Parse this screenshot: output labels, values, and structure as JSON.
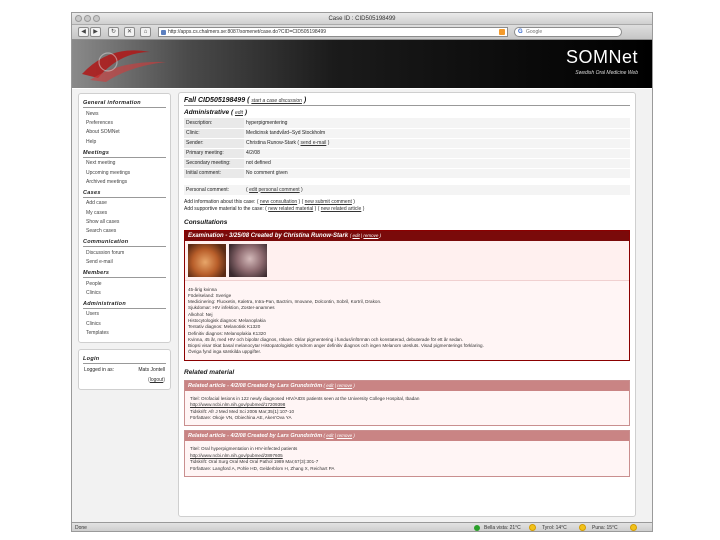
{
  "window": {
    "title": "Case ID : CID505198499"
  },
  "toolbar": {
    "back": "◀",
    "forward": "▶",
    "reload": "↻",
    "stop": "✕",
    "home": "⌂",
    "url": "http://apps.cs.chalmers.se:8087/somenet/case.do?CID=CID505198499",
    "search_placeholder": "Google",
    "search_g": "G"
  },
  "header": {
    "brand": "SOMNet",
    "tagline": "Swedish Oral Medicine Web"
  },
  "sidebar": {
    "sections": [
      {
        "title": "General information",
        "items": [
          "News",
          "Preferences",
          "About SOMNet",
          "Help"
        ]
      },
      {
        "title": "Meetings",
        "items": [
          "Next meeting",
          "Upcoming meetings",
          "Archived meetings"
        ]
      },
      {
        "title": "Cases",
        "items": [
          "Add case",
          "My cases",
          "Show all cases",
          "Search cases"
        ]
      },
      {
        "title": "Communication",
        "items": [
          "Discussion forum",
          "Send e-mail"
        ]
      },
      {
        "title": "Members",
        "items": [
          "People",
          "Clinics"
        ]
      },
      {
        "title": "Administration",
        "items": [
          "Users",
          "Clinics",
          "Templates"
        ]
      }
    ],
    "login": {
      "title": "Login",
      "logged_label": "Logged in as:",
      "logged_user": "Mats Jontell",
      "logout": "logout"
    }
  },
  "case": {
    "title": "Fall CID505198499",
    "start_discussion": "start a case discussion"
  },
  "administrative": {
    "title": "Administrative",
    "edit": "edit",
    "rows": [
      {
        "key": "Description:",
        "value": "hyperpigmentering"
      },
      {
        "key": "Clinic:",
        "value": "Medicinsk tandvård–Syd Stockholm"
      },
      {
        "key": "Sender:",
        "value": "Christina Runow-Stark",
        "link": "send e-mail"
      },
      {
        "key": "Primary meeting:",
        "value": "4/2/08"
      },
      {
        "key": "Secondary meeting:",
        "value": "not defined"
      },
      {
        "key": "Initial comment:",
        "value": "No comment given"
      }
    ],
    "personal_key": "Personal comment:",
    "personal_link": "edit personal comment"
  },
  "addinfo": {
    "line1_prefix": "Add information about this case:",
    "line1_links": [
      "new consultation",
      "new submit comment"
    ],
    "line2_prefix": "Add supportive material to the case:",
    "line2_links": [
      "new related material",
      "new related article"
    ]
  },
  "consultations": {
    "title": "Consultations",
    "exam_title": "Examination - 3/25/08 Created by Christina Runow-Stark",
    "exam_links": [
      "edit",
      "remove"
    ],
    "text_lines": [
      "45-årig kvinna",
      "Födelseland: Sverige",
      "Medicinering: Fluoxetin, Kaletra, Intra-Pan, Bactrim, Imovane, Dolcontin, Sobril, Kortril, Drakon.",
      "Sjukdomar: HIV infektion, Zoster-anamnes",
      "Alkohol: Nej",
      "Histocytologisk diagnos: Melanoplakia",
      "Tentativ diagnos: Melanotisk K1320",
      "Definitiv diagnos: Melanoplakia K1320",
      "Kvinna, 45 år, med HIV och bipolär diagnos, rökare. Oklar pigmentering i fundus/införmän och konstaterad, debuterade för ett år sedan.",
      "Biopsi visar ökat basal melanocytar Histopatologiskt syndrom anger definitiv diagnos och ingen Melanom utesluts. Visad pigmenterings förklaring.",
      "Övriga fynd inga särskilda uppgifter."
    ]
  },
  "related": {
    "title": "Related material",
    "articles": [
      {
        "header": "Related article - 4/2/08 Created by Lars Grundström",
        "links": [
          "edit",
          "remove"
        ],
        "lines": [
          "Titel: Orofacial lesions in 122 newly diagnosed HIV/AIDS patients seen at the University College Hospital, Ibadan",
          "http://www.ncbi.nlm.nih.gov/pubmed/17209398",
          "Tidskrift: Afr J Med Med Sci 2006 Mar;35(1):107-10",
          "Författare: Okoje VN, Obiechina AE, Aken'Ova YA"
        ]
      },
      {
        "header": "Related article - 4/2/08 Created by Lars Grundström",
        "links": [
          "edit",
          "remove"
        ],
        "lines": [
          "Titel: Oral hyperpigmentation in HIV-infected patients",
          "http://www.ncbi.nlm.nih.gov/pubmed/2897605",
          "Tidskrift: Oral Surg Oral Med Oral Pathol 1989 Mar;67(3):301-7",
          "Författare: Langford A, Pohle HD, Gelderblom H, Zhang X, Reichart PA"
        ]
      }
    ]
  },
  "status": {
    "done": "Done",
    "weather": [
      "Bella vista: 21°C",
      "Tyrol: 14°C",
      "Puna: 15°C"
    ]
  }
}
